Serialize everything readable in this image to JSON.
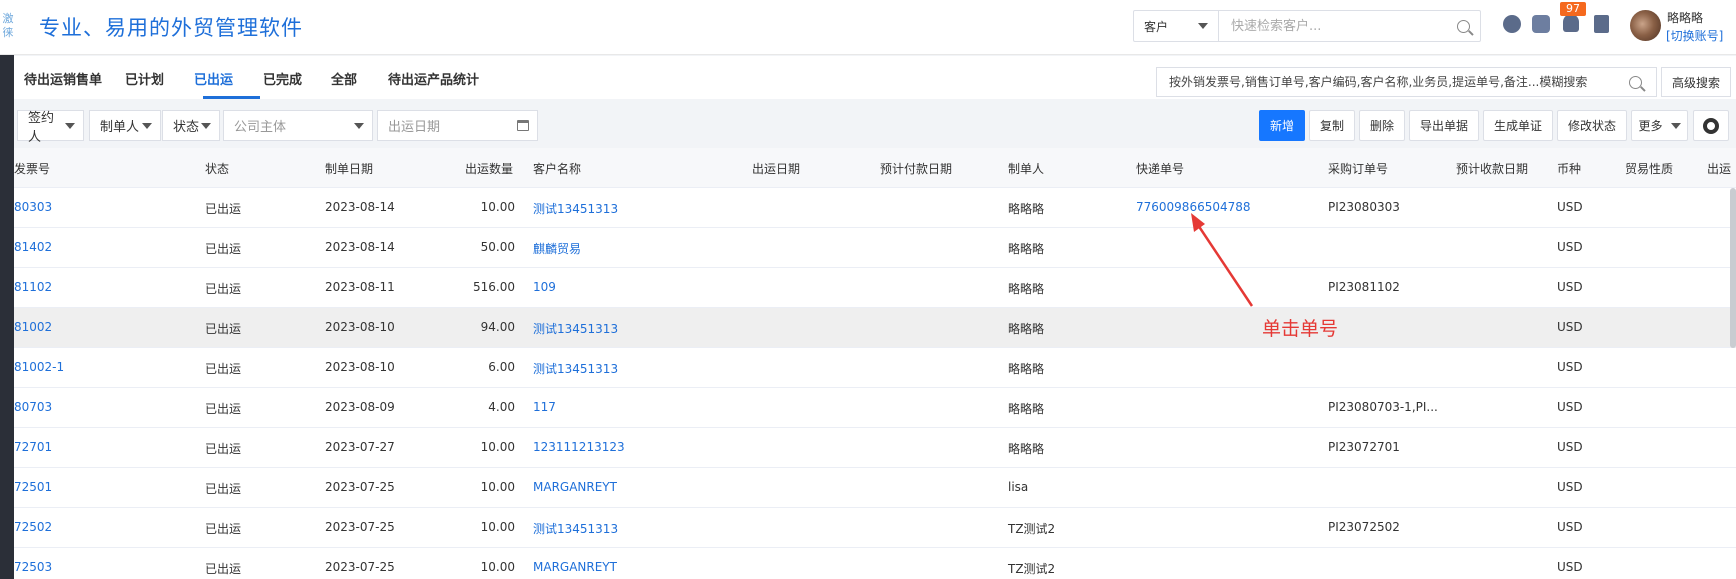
{
  "header": {
    "logo_text": "激\n徕",
    "brand_title": "专业、易用的外贸管理软件",
    "search_scope": "客户",
    "search_placeholder": "快速检索客户...",
    "notification_count": "97",
    "user_name": "略略略",
    "switch_account": "[切换账号]"
  },
  "tabs": [
    {
      "label": "待出运销售单"
    },
    {
      "label": "已计划"
    },
    {
      "label": "已出运"
    },
    {
      "label": "已完成"
    },
    {
      "label": "全部"
    },
    {
      "label": "待出运产品统计"
    }
  ],
  "active_tab": "已出运",
  "fuzzy_search_placeholder": "按外销发票号,销售订单号,客户编码,客户名称,业务员,提运单号,备注...模糊搜索",
  "advanced_search": "高级搜索",
  "filters": {
    "signer": "签约人",
    "creator": "制单人",
    "status": "状态",
    "company_placeholder": "公司主体",
    "date_placeholder": "出运日期"
  },
  "actions": {
    "new": "新增",
    "copy": "复制",
    "delete": "删除",
    "export": "导出单据",
    "voucher": "生成单证",
    "modify_status": "修改状态",
    "more": "更多"
  },
  "columns": [
    "发票号",
    "状态",
    "制单日期",
    "出运数量",
    "客户名称",
    "出运日期",
    "预计付款日期",
    "制单人",
    "快递单号",
    "采购订单号",
    "预计收款日期",
    "币种",
    "贸易性质",
    "出运"
  ],
  "rows": [
    {
      "invoice": "80303",
      "status": "已出运",
      "date": "2023-08-14",
      "qty": "10.00",
      "customer": "测试13451313",
      "creator": "略略略",
      "express": "776009866504788",
      "po": "PI23080303",
      "currency": "USD"
    },
    {
      "invoice": "81402",
      "status": "已出运",
      "date": "2023-08-14",
      "qty": "50.00",
      "customer": "麒麟贸易",
      "creator": "略略略",
      "express": "",
      "po": "",
      "currency": "USD"
    },
    {
      "invoice": "81102",
      "status": "已出运",
      "date": "2023-08-11",
      "qty": "516.00",
      "customer": "109",
      "creator": "略略略",
      "express": "",
      "po": "PI23081102",
      "currency": "USD"
    },
    {
      "invoice": "81002",
      "status": "已出运",
      "date": "2023-08-10",
      "qty": "94.00",
      "customer": "测试13451313",
      "creator": "略略略",
      "express": "",
      "po": "",
      "currency": "USD"
    },
    {
      "invoice": "81002-1",
      "status": "已出运",
      "date": "2023-08-10",
      "qty": "6.00",
      "customer": "测试13451313",
      "creator": "略略略",
      "express": "",
      "po": "",
      "currency": "USD"
    },
    {
      "invoice": "80703",
      "status": "已出运",
      "date": "2023-08-09",
      "qty": "4.00",
      "customer": "117",
      "creator": "略略略",
      "express": "",
      "po": "PI23080703-1,PI...",
      "currency": "USD"
    },
    {
      "invoice": "72701",
      "status": "已出运",
      "date": "2023-07-27",
      "qty": "10.00",
      "customer": "123111213123",
      "creator": "略略略",
      "express": "",
      "po": "PI23072701",
      "currency": "USD"
    },
    {
      "invoice": "72501",
      "status": "已出运",
      "date": "2023-07-25",
      "qty": "10.00",
      "customer": "MARGANREYT",
      "creator": "lisa",
      "express": "",
      "po": "",
      "currency": "USD"
    },
    {
      "invoice": "72502",
      "status": "已出运",
      "date": "2023-07-25",
      "qty": "10.00",
      "customer": "测试13451313",
      "creator": "TZ测试2",
      "express": "",
      "po": "PI23072502",
      "currency": "USD"
    },
    {
      "invoice": "72503",
      "status": "已出运",
      "date": "2023-07-25",
      "qty": "10.00",
      "customer": "MARGANREYT",
      "creator": "TZ测试2",
      "express": "",
      "po": "",
      "currency": "USD"
    }
  ],
  "annotation": "单击单号",
  "colors": {
    "accent": "#1e6fd9",
    "primary_button": "#1677ff",
    "badge": "#f5691e",
    "annotation": "#e53935"
  }
}
